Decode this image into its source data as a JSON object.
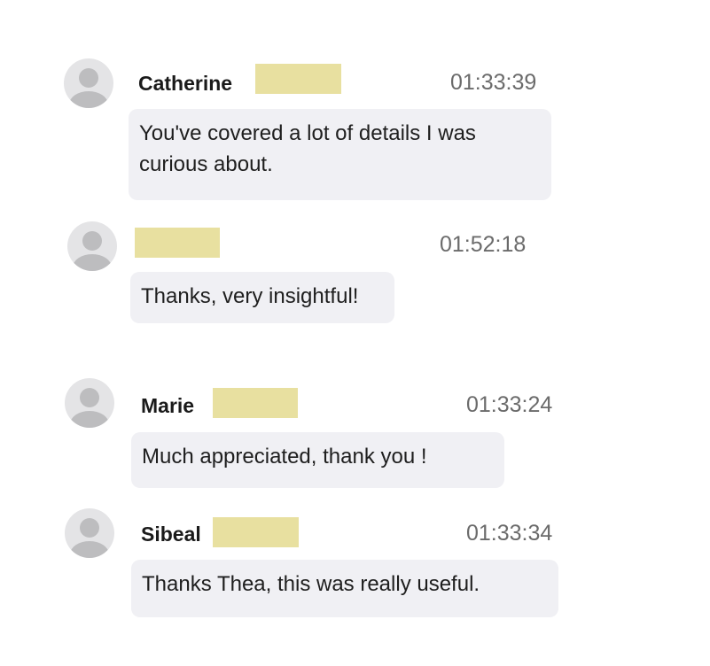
{
  "messages": [
    {
      "name": "Catherine",
      "time": "01:33:39",
      "text": "You've covered a lot of details I was curious about."
    },
    {
      "name": "",
      "time": "01:52:18",
      "text": "Thanks, very insightful!"
    },
    {
      "name": "Marie",
      "time": "01:33:24",
      "text": "Much appreciated, thank you !"
    },
    {
      "name": "Sibeal",
      "time": "01:33:34",
      "text": "Thanks Thea, this was really useful."
    }
  ],
  "icons": {
    "avatar": "user-avatar-icon"
  },
  "colors": {
    "bubble": "#f0f0f4",
    "redaction": "#e8e0a0",
    "avatar_bg": "#e4e4e6",
    "avatar_fg": "#bdbdbf"
  }
}
